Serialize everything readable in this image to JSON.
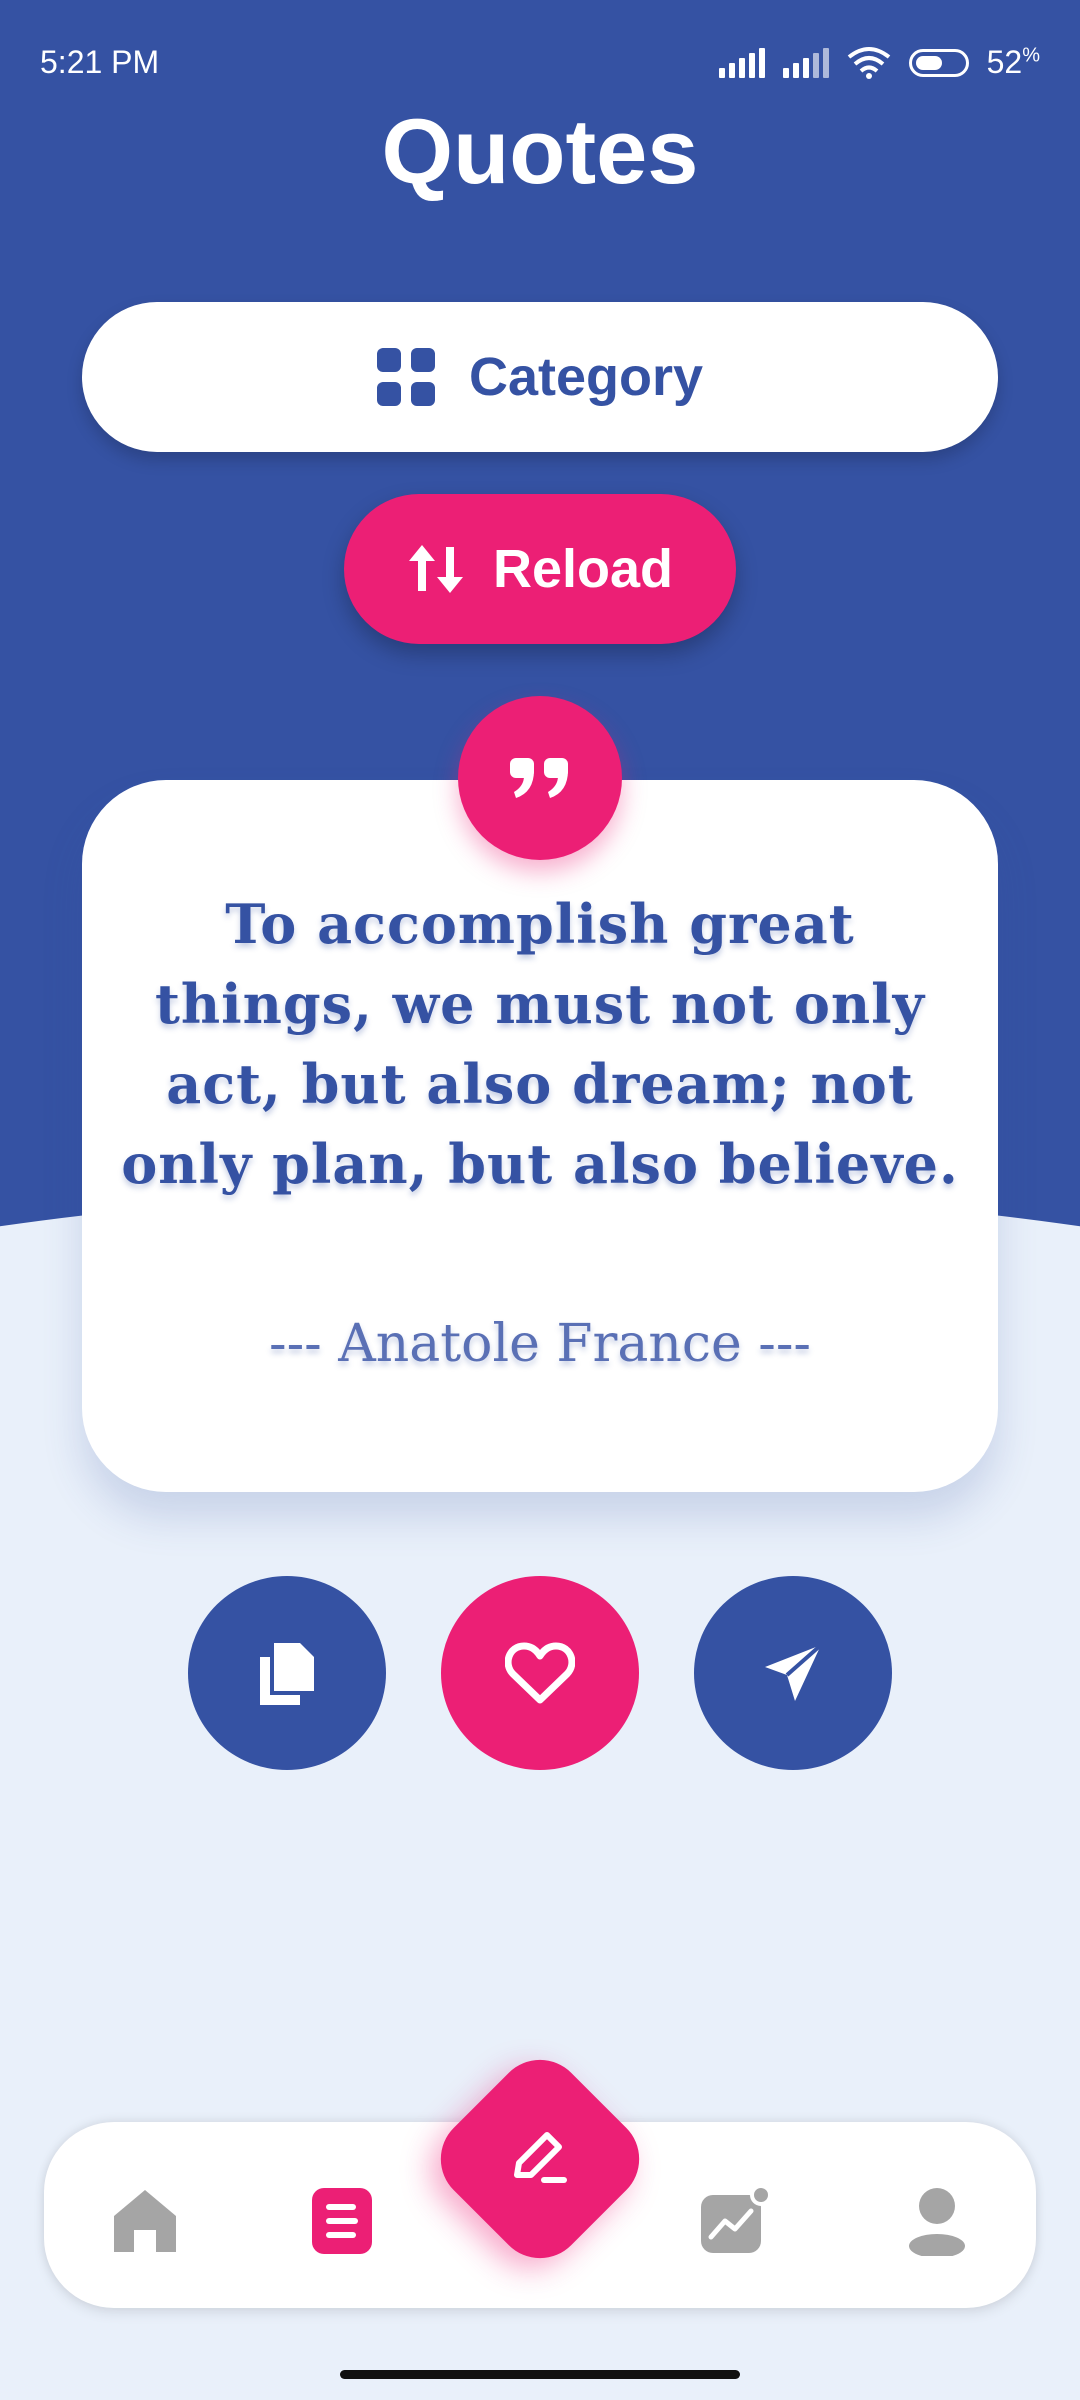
{
  "status_bar": {
    "time": "5:21 PM",
    "battery": "52",
    "battery_unit": "%"
  },
  "header": {
    "title": "Quotes"
  },
  "buttons": {
    "category_label": "Category",
    "reload_label": "Reload"
  },
  "quote": {
    "text": "To accomplish great things, we must not only act, but also dream; not only plan, but also believe.",
    "author": "--- Anatole France ---"
  },
  "actions": [
    {
      "name": "copy",
      "icon": "copy-icon"
    },
    {
      "name": "favorite",
      "icon": "heart-icon"
    },
    {
      "name": "share",
      "icon": "send-icon"
    }
  ],
  "bottom_nav": {
    "items": [
      "home-icon",
      "quotes-icon",
      "edit-icon",
      "stats-icon",
      "profile-icon"
    ],
    "active": "quotes-icon"
  },
  "colors": {
    "primary": "#3552a3",
    "accent": "#ec1f75",
    "background": "#e9f0fa",
    "inactive": "#a5a5a5"
  }
}
